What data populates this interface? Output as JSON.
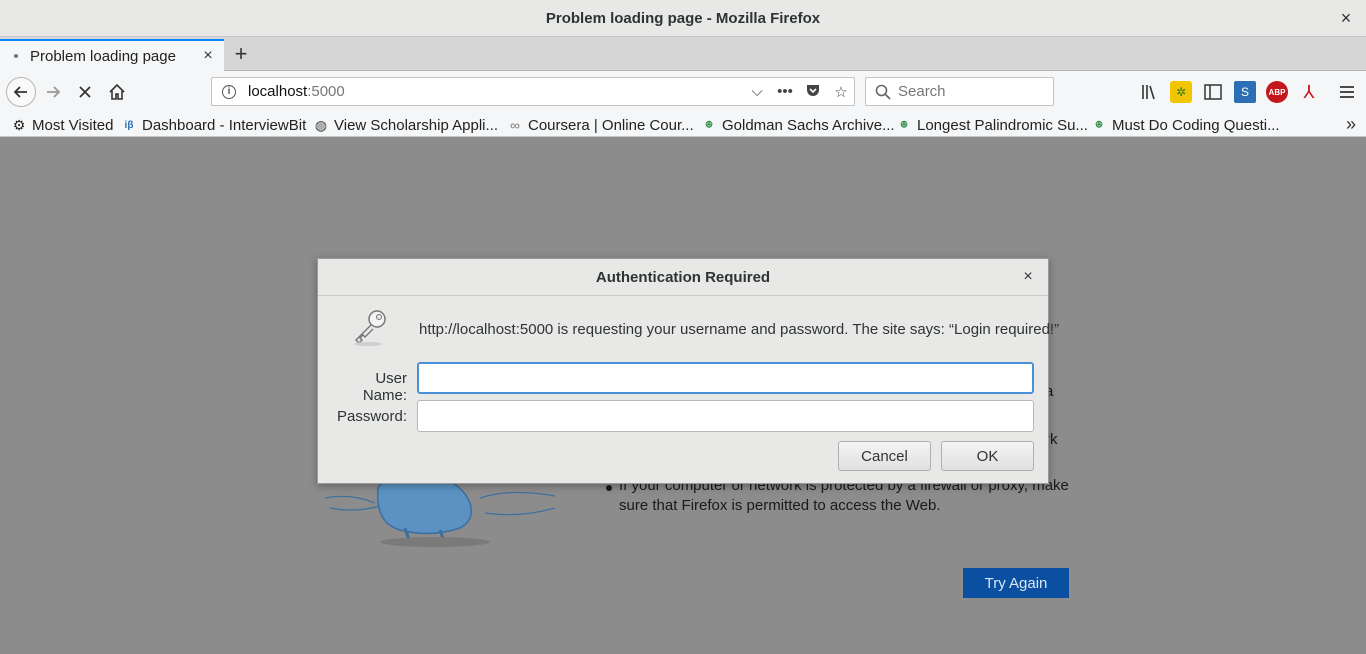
{
  "window": {
    "title": "Problem loading page - Mozilla Firefox",
    "close": "×"
  },
  "tabs": [
    {
      "label": "Problem loading page",
      "close": "×"
    }
  ],
  "new_tab": "+",
  "nav": {
    "url_host": "localhost",
    "url_port": ":5000",
    "search_placeholder": "Search"
  },
  "bookmarks": [
    {
      "label": "Most Visited",
      "icon": "gear-icon",
      "fav": "⚙"
    },
    {
      "label": "Dashboard - InterviewBit",
      "icon": "interviewbit-icon",
      "fav": "iβ"
    },
    {
      "label": "View Scholarship Appli...",
      "icon": "globe-icon",
      "fav": "◍"
    },
    {
      "label": "Coursera | Online Cour...",
      "icon": "coursera-icon",
      "fav": "∞"
    },
    {
      "label": "Goldman Sachs Archive...",
      "icon": "gfg-icon",
      "fav": "ꔮ"
    },
    {
      "label": "Longest Palindromic Su...",
      "icon": "gfg-icon",
      "fav": "ꔮ"
    },
    {
      "label": "Must Do Coding Questi...",
      "icon": "gfg-icon",
      "fav": "ꔮ"
    }
  ],
  "content": {
    "partial_line_1": "a",
    "partial_line_2": "rk",
    "bullet_line_1": "If your computer or network is protected by a firewall or proxy, make",
    "bullet_line_2": "sure that Firefox is permitted to access the Web.",
    "try_again": "Try Again"
  },
  "dialog": {
    "title": "Authentication Required",
    "close": "×",
    "message": "http://localhost:5000 is requesting your username and password. The site says: “Login required!”",
    "username_label": "User Name:",
    "username_value": "",
    "password_label": "Password:",
    "password_value": "",
    "cancel": "Cancel",
    "ok": "OK"
  },
  "colors": {
    "accent": "#0a84ff",
    "try_again_bg": "#0a4fa0",
    "focus": "#4a90d9"
  }
}
